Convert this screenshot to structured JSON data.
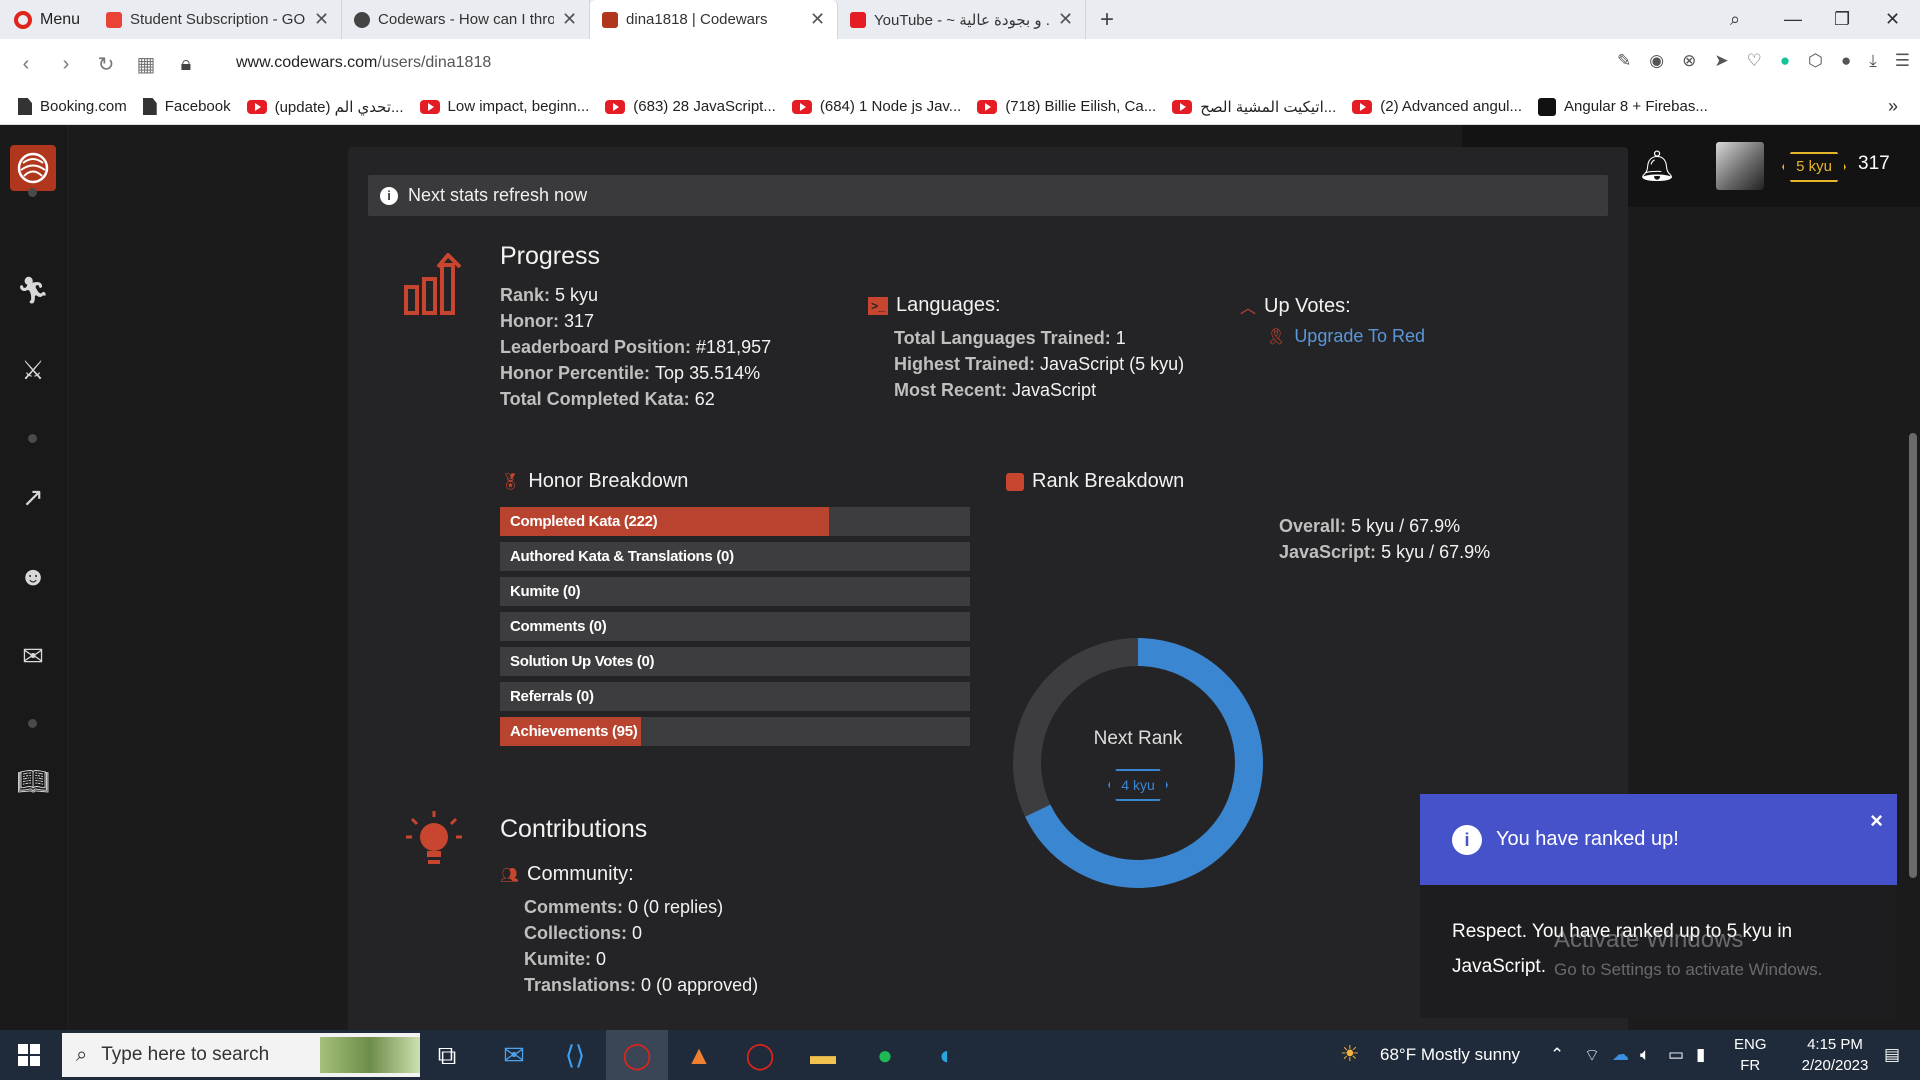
{
  "browser": {
    "menu_label": "Menu",
    "tabs": [
      {
        "title": "Student Subscription - GO",
        "favicon_color": "#ea4335"
      },
      {
        "title": "Codewars - How can I thro",
        "favicon_color": "#444444"
      },
      {
        "title": "dina1818 | Codewars",
        "favicon_color": "#b1361e"
      },
      {
        "title": "YouTube - ~ و بجودة عالية ...",
        "favicon_color": "#e51c23"
      }
    ],
    "url_host": "www.codewars.com",
    "url_path": "/users/dina1818",
    "bookmarks": [
      {
        "label": "Booking.com",
        "icon": "doc-icon"
      },
      {
        "label": "Facebook",
        "icon": "doc-icon"
      },
      {
        "label": "(update) تحدي الم...",
        "icon": "youtube-icon"
      },
      {
        "label": "Low impact, beginn...",
        "icon": "youtube-icon"
      },
      {
        "label": "(683) 28 JavaScript...",
        "icon": "youtube-icon"
      },
      {
        "label": "(684) 1 Node js Jav...",
        "icon": "youtube-icon"
      },
      {
        "label": "(718) Billie Eilish, Ca...",
        "icon": "youtube-icon"
      },
      {
        "label": "اتيكيت المشية الصح...",
        "icon": "youtube-icon"
      },
      {
        "label": "(2) Advanced angul...",
        "icon": "youtube-icon"
      },
      {
        "label": "Angular 8 + Firebas...",
        "icon": "medium-icon"
      }
    ]
  },
  "header": {
    "rank_badge": "5 kyu",
    "honor": "317"
  },
  "refresh_notice": "Next stats refresh now",
  "progress": {
    "title": "Progress",
    "stats": [
      {
        "key": "Rank:",
        "value": "5 kyu"
      },
      {
        "key": "Honor:",
        "value": "317"
      },
      {
        "key": "Leaderboard Position:",
        "value": "#181,957"
      },
      {
        "key": "Honor Percentile:",
        "value": "Top 35.514%"
      },
      {
        "key": "Total Completed Kata:",
        "value": "62"
      }
    ],
    "languages_title": "Languages:",
    "languages": [
      {
        "key": "Total Languages Trained:",
        "value": "1"
      },
      {
        "key": "Highest Trained:",
        "value": "JavaScript (5 kyu)"
      },
      {
        "key": "Most Recent:",
        "value": "JavaScript"
      }
    ],
    "upvotes_title": "Up Votes:",
    "upvotes_link": "Upgrade To Red"
  },
  "honor_breakdown": {
    "title": "Honor Breakdown",
    "bars": [
      {
        "label": "Completed Kata (222)",
        "fill": 0.7
      },
      {
        "label": "Authored Kata & Translations (0)",
        "fill": 0
      },
      {
        "label": "Kumite (0)",
        "fill": 0
      },
      {
        "label": "Comments (0)",
        "fill": 0
      },
      {
        "label": "Solution Up Votes (0)",
        "fill": 0
      },
      {
        "label": "Referrals (0)",
        "fill": 0
      },
      {
        "label": "Achievements (95)",
        "fill": 0.3
      }
    ]
  },
  "rank_breakdown": {
    "title": "Rank Breakdown",
    "progress": 0.679,
    "center_label": "Next Rank",
    "next_rank": "4 kyu",
    "stats": [
      {
        "key": "Overall:",
        "value": "5 kyu / 67.9%"
      },
      {
        "key": "JavaScript:",
        "value": "5 kyu / 67.9%"
      }
    ]
  },
  "contributions": {
    "title": "Contributions",
    "community_title": "Community:",
    "stats": [
      {
        "key": "Comments:",
        "value": "0 (0 replies)"
      },
      {
        "key": "Collections:",
        "value": "0"
      },
      {
        "key": "Kumite:",
        "value": "0"
      },
      {
        "key": "Translations:",
        "value": "0 (0 approved)"
      }
    ]
  },
  "toast": {
    "title": "You have ranked up!",
    "close": "×",
    "message_line1": "Respect. You have ranked up to 5 kyu in",
    "message_line2": "JavaScript."
  },
  "watermark": {
    "line1": "Activate Windows",
    "line2": "Go to Settings to activate Windows."
  },
  "taskbar": {
    "search_placeholder": "Type here to search",
    "weather": "68°F  Mostly sunny",
    "lang_top": "ENG",
    "lang_bottom": "FR",
    "time": "4:15 PM",
    "date": "2/20/2023"
  },
  "colors": {
    "accent_red": "#b8432f",
    "rank_blue": "#3a86d1",
    "kyu_yellow": "#e6b52a",
    "toast_blue": "#4652c9"
  }
}
